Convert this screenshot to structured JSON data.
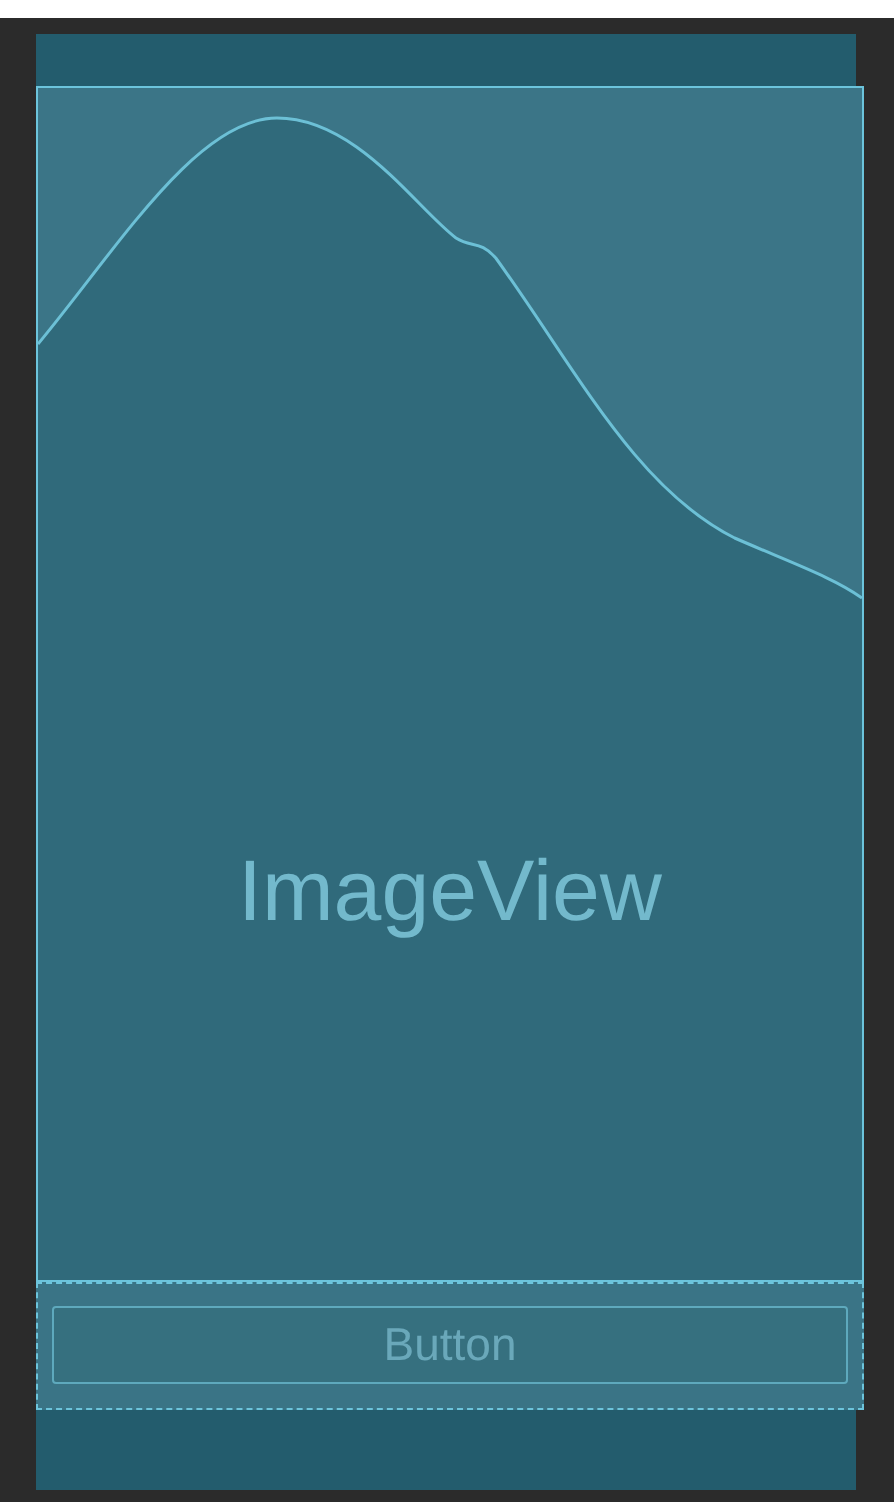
{
  "image_view": {
    "label": "ImageView"
  },
  "button": {
    "label": "Button"
  }
}
